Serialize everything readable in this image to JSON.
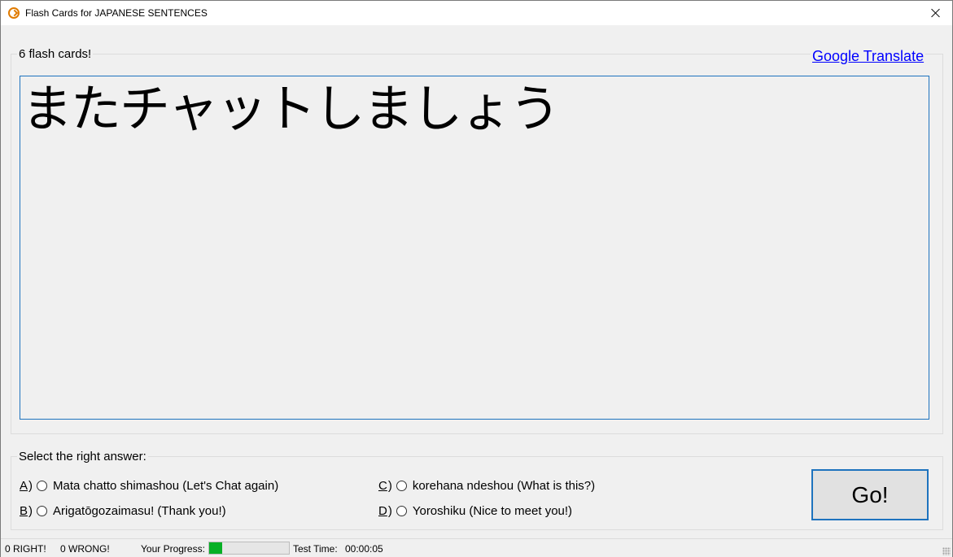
{
  "window": {
    "title": "Flash Cards for JAPANESE SENTENCES",
    "icon": "app-play-icon"
  },
  "card_section": {
    "legend": "6 flash cards!",
    "link": "Google Translate",
    "card_text": "またチャットしましょう"
  },
  "answers": {
    "legend": "Select the right answer:",
    "options": [
      {
        "letter": "A",
        "paren": ")",
        "text": "Mata chatto shimashou (Let's Chat again)"
      },
      {
        "letter": "B",
        "paren": ")",
        "text": "Arigatōgozaimasu! (Thank you!)"
      },
      {
        "letter": "C",
        "paren": ")",
        "text": "korehana ndeshou (What is this?)"
      },
      {
        "letter": "D",
        "paren": ")",
        "text": "Yoroshiku (Nice to meet you!)"
      }
    ],
    "go_label": "Go!"
  },
  "status": {
    "right": "0 RIGHT!",
    "wrong": "0 WRONG!",
    "progress_label": "Your Progress:",
    "progress_value": 0.16,
    "time_label": "Test Time:",
    "time_value": "00:00:05"
  },
  "colors": {
    "accent": "#1e73be",
    "link": "#0000ff",
    "progress": "#06b025"
  }
}
